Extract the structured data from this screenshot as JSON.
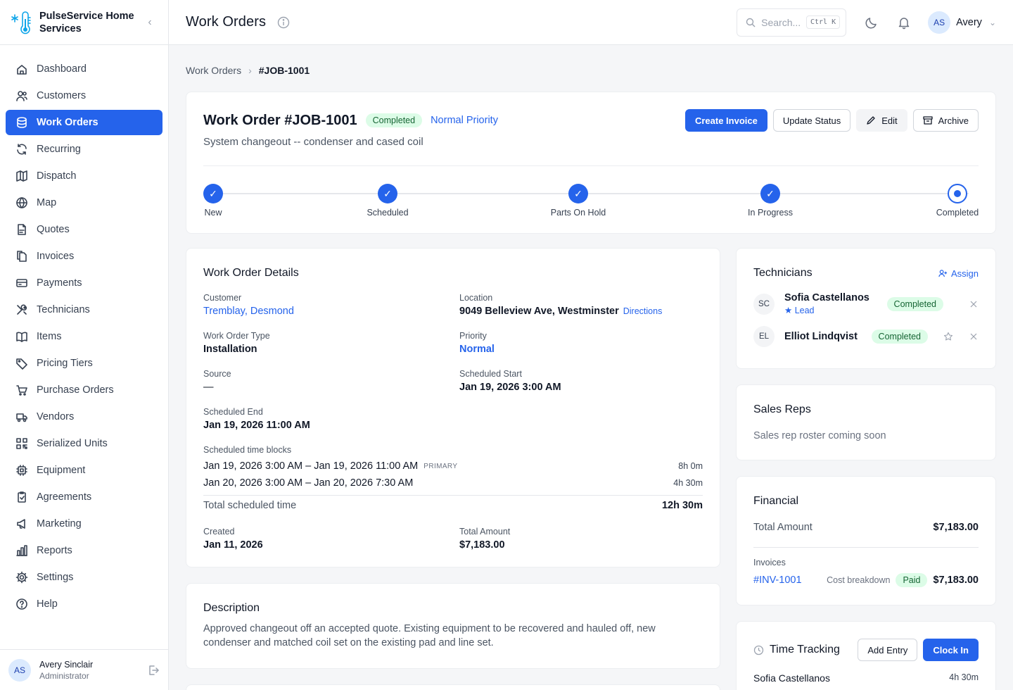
{
  "app": {
    "name": "PulseService Home Services"
  },
  "nav": [
    {
      "label": "Dashboard",
      "icon": "home-icon"
    },
    {
      "label": "Customers",
      "icon": "users-icon"
    },
    {
      "label": "Work Orders",
      "icon": "database-icon",
      "active": true
    },
    {
      "label": "Recurring",
      "icon": "refresh-icon"
    },
    {
      "label": "Dispatch",
      "icon": "map-book-icon"
    },
    {
      "label": "Map",
      "icon": "globe-icon"
    },
    {
      "label": "Quotes",
      "icon": "document-icon"
    },
    {
      "label": "Invoices",
      "icon": "files-icon"
    },
    {
      "label": "Payments",
      "icon": "credit-card-icon"
    },
    {
      "label": "Technicians",
      "icon": "tools-icon"
    },
    {
      "label": "Items",
      "icon": "book-icon"
    },
    {
      "label": "Pricing Tiers",
      "icon": "tag-icon"
    },
    {
      "label": "Purchase Orders",
      "icon": "cart-icon"
    },
    {
      "label": "Vendors",
      "icon": "truck-icon"
    },
    {
      "label": "Serialized Units",
      "icon": "qr-icon"
    },
    {
      "label": "Equipment",
      "icon": "chip-icon"
    },
    {
      "label": "Agreements",
      "icon": "clipboard-icon"
    },
    {
      "label": "Marketing",
      "icon": "megaphone-icon"
    },
    {
      "label": "Reports",
      "icon": "bar-chart-icon"
    },
    {
      "label": "Settings",
      "icon": "gear-icon"
    },
    {
      "label": "Help",
      "icon": "help-icon"
    }
  ],
  "user": {
    "initials": "AS",
    "name": "Avery Sinclair",
    "role": "Administrator",
    "first_name": "Avery"
  },
  "topbar": {
    "title": "Work Orders",
    "search_placeholder": "Search...",
    "search_kbd": "Ctrl K"
  },
  "breadcrumb": {
    "parent": "Work Orders",
    "current": "#JOB-1001"
  },
  "work_order": {
    "title": "Work Order #JOB-1001",
    "status": "Completed",
    "priority": "Normal Priority",
    "subtitle": "System changeout -- condenser and cased coil",
    "actions": {
      "create_invoice": "Create Invoice",
      "update_status": "Update Status",
      "edit": "Edit",
      "archive": "Archive"
    },
    "steps": [
      {
        "label": "New",
        "done": true
      },
      {
        "label": "Scheduled",
        "done": true
      },
      {
        "label": "Parts On Hold",
        "done": true
      },
      {
        "label": "In Progress",
        "done": true
      },
      {
        "label": "Completed",
        "current": true
      }
    ]
  },
  "details": {
    "title": "Work Order Details",
    "customer_label": "Customer",
    "customer": "Tremblay, Desmond",
    "location_label": "Location",
    "location": "9049 Belleview Ave, Westminster",
    "directions": "Directions",
    "type_label": "Work Order Type",
    "type": "Installation",
    "priority_label": "Priority",
    "priority": "Normal",
    "source_label": "Source",
    "source": "—",
    "start_label": "Scheduled Start",
    "start": "Jan 19, 2026 3:00 AM",
    "end_label": "Scheduled End",
    "end": "Jan 19, 2026 11:00 AM",
    "blocks_label": "Scheduled time blocks",
    "blocks": [
      {
        "range": "Jan 19, 2026 3:00 AM – Jan 19, 2026 11:00 AM",
        "tag": "PRIMARY",
        "duration": "8h 0m"
      },
      {
        "range": "Jan 20, 2026 3:00 AM – Jan 20, 2026 7:30 AM",
        "tag": "",
        "duration": "4h 30m"
      }
    ],
    "total_label": "Total scheduled time",
    "total": "12h 30m",
    "created_label": "Created",
    "created": "Jan 11, 2026",
    "amount_label": "Total Amount",
    "amount": "$7,183.00"
  },
  "description": {
    "title": "Description",
    "text": "Approved changeout off an accepted quote. Existing equipment to be recovered and hauled off, new condenser and matched coil set on the existing pad and line set."
  },
  "technicians": {
    "title": "Technicians",
    "assign": "Assign",
    "list": [
      {
        "initials": "SC",
        "name": "Sofia Castellanos",
        "lead": "Lead",
        "status": "Completed"
      },
      {
        "initials": "EL",
        "name": "Elliot Lindqvist",
        "lead": "",
        "status": "Completed"
      }
    ]
  },
  "sales_reps": {
    "title": "Sales Reps",
    "empty": "Sales rep roster coming soon"
  },
  "financial": {
    "title": "Financial",
    "total_label": "Total Amount",
    "total": "$7,183.00",
    "invoices_label": "Invoices",
    "invoice_id": "#INV-1001",
    "cost_breakdown": "Cost breakdown",
    "invoice_status": "Paid",
    "invoice_amount": "$7,183.00"
  },
  "time_tracking": {
    "title": "Time Tracking",
    "add_entry": "Add Entry",
    "clock_in": "Clock In",
    "entries": [
      {
        "name": "Sofia Castellanos",
        "duration": "4h 30m"
      }
    ]
  },
  "colors": {
    "accent": "#2563eb",
    "success_bg": "#dcfce7",
    "success_text": "#166534"
  }
}
